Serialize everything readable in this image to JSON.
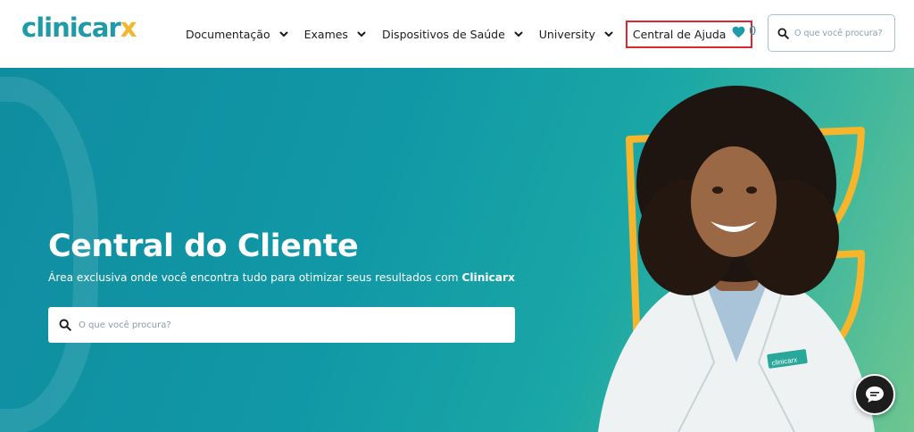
{
  "header": {
    "logo": {
      "main": "clinicar",
      "accent": "x"
    },
    "nav": [
      {
        "label": "Documentação"
      },
      {
        "label": "Exames"
      },
      {
        "label": "Dispositivos de Saúde"
      },
      {
        "label": "University"
      },
      {
        "label": "Central de Ajuda",
        "highlighted": true
      }
    ],
    "favorites_count": "0",
    "search_placeholder": "O que você procura?"
  },
  "hero": {
    "title": "Central do Cliente",
    "subtitle": "Área exclusiva onde você encontra tudo para otimizar seus resultados com ",
    "subtitle_brand": "Clinicarx",
    "search_placeholder": "O que você procura?",
    "badge_text": "clinicarx"
  },
  "icons": {
    "heart": "heart-icon",
    "search": "search-icon",
    "chevron": "chevron-down-icon",
    "chat": "chat-icon"
  },
  "colors": {
    "brand_teal": "#1f9aa8",
    "brand_yellow": "#f6b52a",
    "highlight_red": "#d9282f",
    "chat_bg": "#1d1d1d"
  }
}
